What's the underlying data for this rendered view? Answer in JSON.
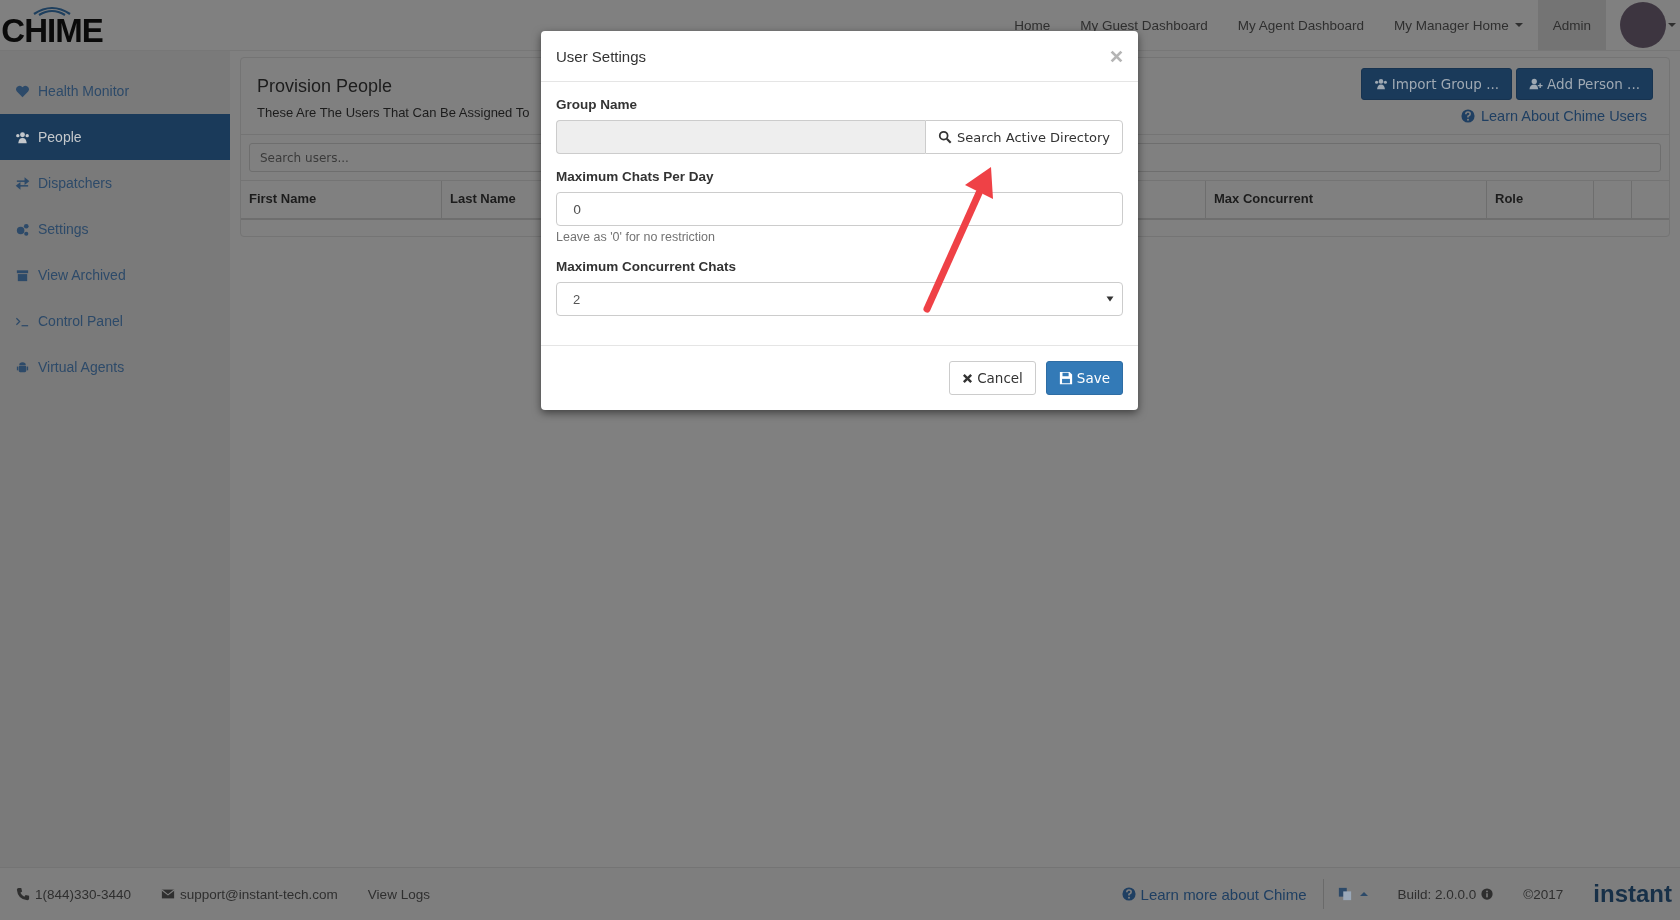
{
  "logo": {
    "text": "CHIME"
  },
  "nav": [
    {
      "label": "Home",
      "selected": false,
      "dropdown": false
    },
    {
      "label": "My Guest Dashboard",
      "selected": false,
      "dropdown": false
    },
    {
      "label": "My Agent Dashboard",
      "selected": false,
      "dropdown": false
    },
    {
      "label": "My Manager Home",
      "selected": false,
      "dropdown": true
    },
    {
      "label": "Admin",
      "selected": true,
      "dropdown": false
    }
  ],
  "sidebar": {
    "items": [
      {
        "label": "Health Monitor",
        "selected": false
      },
      {
        "label": "People",
        "selected": true
      },
      {
        "label": "Dispatchers",
        "selected": false
      },
      {
        "label": "Settings",
        "selected": false
      },
      {
        "label": "View Archived",
        "selected": false
      },
      {
        "label": "Control Panel",
        "selected": false
      },
      {
        "label": "Virtual Agents",
        "selected": false
      }
    ]
  },
  "panel": {
    "title": "Provision People",
    "subtitle": "These Are The Users That Can Be Assigned To",
    "buttons": [
      {
        "label": "Import Group ..."
      },
      {
        "label": "Add Person ..."
      }
    ],
    "help_link": "Learn About Chime Users",
    "search": {
      "placeholder": "Search users..."
    }
  },
  "table": {
    "columns": [
      {
        "label": "First Name",
        "kind": "left"
      },
      {
        "label": "Last Name",
        "kind": "left"
      },
      {
        "label": "Max Concurrent",
        "kind": "right"
      },
      {
        "label": "Role",
        "kind": "right"
      }
    ]
  },
  "modal": {
    "title": "User Settings",
    "fields": [
      {
        "label": "Group Name",
        "kind": "lookup",
        "button": "Search Active Directory"
      },
      {
        "label": "Maximum Chats Per Day",
        "kind": "text",
        "value": "0",
        "help": "Leave as '0' for no restriction"
      },
      {
        "label": "Maximum Concurrent Chats",
        "kind": "select",
        "value": "2"
      }
    ],
    "buttons": [
      {
        "label": "Cancel",
        "kind": "default"
      },
      {
        "label": "Save",
        "kind": "primary"
      }
    ]
  },
  "footer": {
    "phone": "1(844)330-3440",
    "email": "support@instant-tech.com",
    "logs": "View Logs",
    "learn": "Learn more about Chime",
    "build": "Build: 2.0.0.0",
    "copyright": "©2017",
    "brand": "instant"
  }
}
